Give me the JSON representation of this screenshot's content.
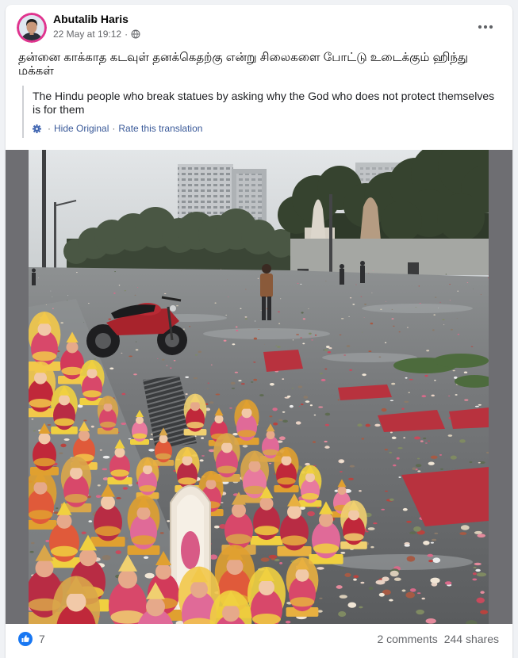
{
  "post": {
    "author": "Abutalib Haris",
    "timestamp": "22 May at 19:12",
    "separator": "·",
    "icons": {
      "audience": "globe-icon",
      "more": "more-options-icon",
      "avatar": "profile-photo"
    },
    "text": "தன்னை காக்காத கடவுள் தனக்கெதற்கு என்று சிலைகளை போட்டு உடைக்கும் ஹிந்து மக்கள்",
    "translation": {
      "text": "The Hindu people who break statues by asking why the God who does not protect themselves is for them",
      "icon": "gear-icon",
      "separator": "·",
      "hide_original": "Hide Original",
      "rate": "Rate this translation"
    }
  },
  "footer": {
    "reaction_icon": "like-icon",
    "reaction_count": "7",
    "comments": "2 comments",
    "shares": "244 shares"
  },
  "colors": {
    "background": "#f0f2f5",
    "card": "#ffffff",
    "text_primary": "#050505",
    "text_secondary": "#65676b",
    "link": "#385898",
    "accent": "#1877f2",
    "avatar_ring": "#e0338e"
  }
}
